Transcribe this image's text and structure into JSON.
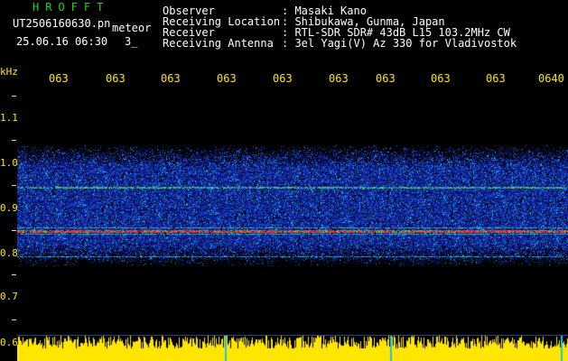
{
  "header": {
    "app_title": "HROFFT",
    "file_name": "UT2506160630.pn",
    "meteor_label": "meteor",
    "datetime": "25.06.16 06:30",
    "count_label": "3_"
  },
  "metadata": [
    {
      "key": "Observer",
      "value": ": Masaki Kano"
    },
    {
      "key": "Receiving Location",
      "value": ": Shibukawa, Gunma, Japan"
    },
    {
      "key": "Receiver",
      "value": ": RTL-SDR SDR# 43dB L15 103.2MHz CW"
    },
    {
      "key": "Receiving Antenna",
      "value": ": 3el Yagi(V) Az 330 for Vladivostok"
    }
  ],
  "axis": {
    "unit": "kHz",
    "time_ticks": [
      "063",
      "063",
      "063",
      "063",
      "063",
      "063",
      "063",
      "063",
      "063",
      "0640"
    ],
    "freq_ticks": [
      "1.1",
      "1.0",
      "0.9",
      "0.8",
      "0.7",
      "0.6"
    ]
  },
  "colors": {
    "axis_text": "#ffe600",
    "title_text": "#19d919",
    "meta_text": "#ffffff",
    "background": "#000000",
    "noise_blue": "#1a3cc8",
    "signal_red": "#ff2a2a",
    "baseline_yellow": "#ffe600"
  }
}
